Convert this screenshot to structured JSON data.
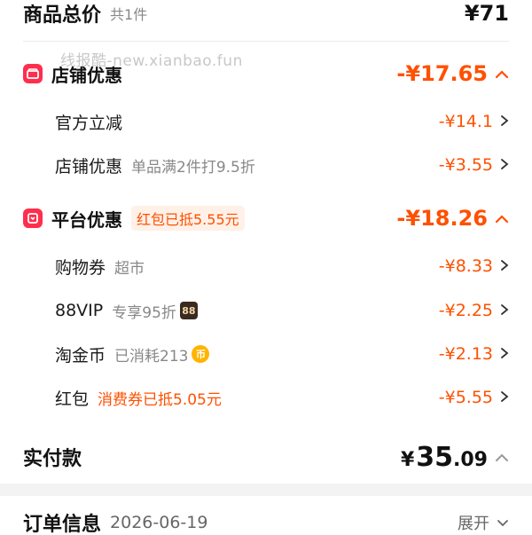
{
  "summary": {
    "title": "商品总价",
    "count": "共1件",
    "total": "¥71"
  },
  "watermark": "线报酷-new.xianbao.fun",
  "store_discount": {
    "label": "店铺优惠",
    "amount": "-¥17.65",
    "items": [
      {
        "label": "官方立减",
        "sub": "",
        "amount": "-¥14.1"
      },
      {
        "label": "店铺优惠",
        "sub": "单品满2件打9.5折",
        "amount": "-¥3.55"
      }
    ]
  },
  "platform_discount": {
    "label": "平台优惠",
    "tag": "红包已抵5.55元",
    "amount": "-¥18.26",
    "items": [
      {
        "label": "购物券",
        "sub": "超市",
        "amount": "-¥8.33"
      },
      {
        "label": "88VIP",
        "sub": "专享95折",
        "badge": "88",
        "amount": "-¥2.25"
      },
      {
        "label": "淘金币",
        "sub": "已消耗213",
        "badge": "币",
        "amount": "-¥2.13"
      },
      {
        "label": "红包",
        "sub": "消费券已抵5.05元",
        "amount": "-¥5.55"
      }
    ]
  },
  "paid": {
    "label": "实付款",
    "currency": "¥",
    "integer": "35",
    "decimal": ".09"
  },
  "order": {
    "label": "订单信息",
    "date": "2026-06-19",
    "expand": "展开"
  },
  "colors": {
    "accent": "#ff5000",
    "badge_red": "#ff2e4d"
  }
}
